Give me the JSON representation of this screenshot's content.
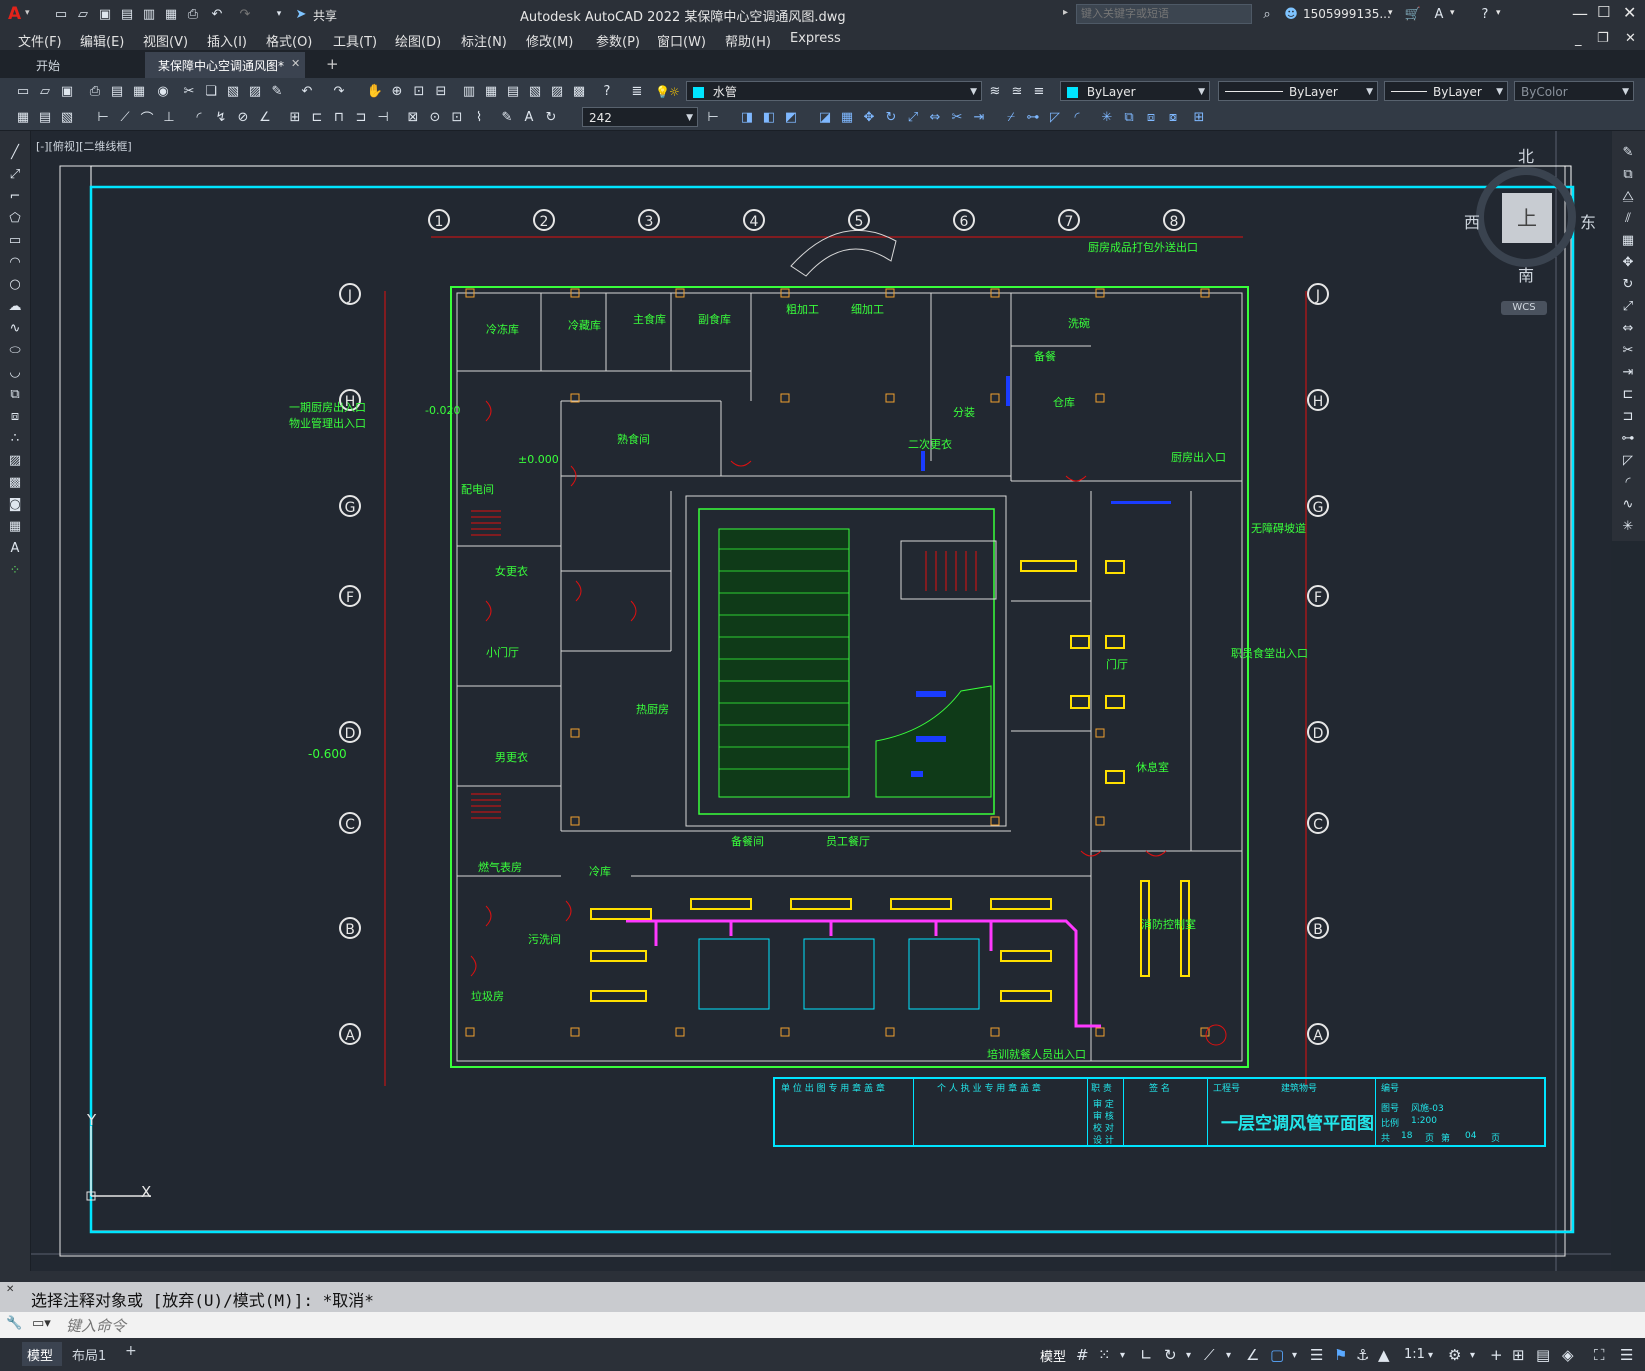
{
  "titlebar": {
    "app_logo": "A",
    "share_label": "共享",
    "window_title": "Autodesk AutoCAD 2022    某保障中心空调通风图.dwg",
    "search_placeholder": "键入关键字或短语",
    "user_name": "1505999135...",
    "help_icon": "question-circle-icon"
  },
  "menu": {
    "items": [
      "文件(F)",
      "编辑(E)",
      "视图(V)",
      "插入(I)",
      "格式(O)",
      "工具(T)",
      "绘图(D)",
      "标注(N)",
      "修改(M)",
      "参数(P)",
      "窗口(W)",
      "帮助(H)",
      "Express"
    ]
  },
  "tabs": {
    "start_label": "开始",
    "active_label": "某保障中心空调通风图*",
    "close_glyph": "✕",
    "add_glyph": "+"
  },
  "properties": {
    "layer_name": "水管",
    "color_value": "ByLayer",
    "linetype_value": "ByLayer",
    "lineweight_value": "ByLayer",
    "plotstyle_value": "ByColor",
    "dim_value": "242"
  },
  "viewport": {
    "label": "[-][俯视][二维线框]"
  },
  "viewcube": {
    "north": "北",
    "south": "南",
    "east": "东",
    "west": "西",
    "face": "上",
    "wcs_label": "WCS"
  },
  "ucs": {
    "y_label": "Y",
    "x_label": "X"
  },
  "drawing": {
    "column_axes": [
      "1",
      "2",
      "3",
      "4",
      "5",
      "6",
      "7",
      "8"
    ],
    "row_axes": [
      "J",
      "H",
      "G",
      "F",
      "D",
      "C",
      "B",
      "A"
    ],
    "room_labels": [
      {
        "text": "冷冻库"
      },
      {
        "text": "冷藏库"
      },
      {
        "text": "主食库"
      },
      {
        "text": "副食库"
      },
      {
        "text": "粗加工"
      },
      {
        "text": "细加工"
      },
      {
        "text": "洗碗"
      },
      {
        "text": "备餐"
      },
      {
        "text": "仓库"
      },
      {
        "text": "分装"
      },
      {
        "text": "厨房出入口"
      },
      {
        "text": "一期厨房出入口"
      },
      {
        "text": "物业管理出入口"
      },
      {
        "text": "熟食间"
      },
      {
        "text": "二次更衣"
      },
      {
        "text": "配电间"
      },
      {
        "text": "女更衣"
      },
      {
        "text": "男更衣"
      },
      {
        "text": "小门厅"
      },
      {
        "text": "热厨房"
      },
      {
        "text": "门厅"
      },
      {
        "text": "休息室"
      },
      {
        "text": "冷库"
      },
      {
        "text": "员工餐厅"
      },
      {
        "text": "备餐间"
      },
      {
        "text": "消防控制室"
      },
      {
        "text": "燃气表房"
      },
      {
        "text": "垃圾房"
      },
      {
        "text": "污洗间"
      },
      {
        "text": "无障碍坡道"
      },
      {
        "text": "职员食堂出入口"
      },
      {
        "text": "培训就餐人员出入口"
      },
      {
        "text": "厨房成品打包外送出口"
      },
      {
        "text": "±0.000"
      },
      {
        "text": "-0.600"
      },
      {
        "text": "-0.020"
      }
    ]
  },
  "title_block": {
    "stamp_unit": "单 位 出 图 专 用 章 盖 章",
    "stamp_person": "个 人 执 业 专 用 章 盖 章",
    "role_header": "职 责",
    "sign_header": "签 名",
    "roles": [
      "审 定",
      "审 核",
      "校 对",
      "设 计"
    ],
    "project_no_label": "工程号",
    "building_no_label": "建筑物号",
    "drawing_title": "一层空调风管平面图",
    "code_label": "编号",
    "drawing_no_label": "图号",
    "drawing_no_value": "风施-03",
    "scale_label": "比例",
    "scale_value": "1:200",
    "total_label": "共",
    "total_value": "18",
    "page_unit": "页",
    "sheet_label": "第",
    "sheet_value": "04",
    "sheet_unit": "页"
  },
  "command": {
    "history_text": "选择注释对象或 [放弃(U)/模式(M)]: *取消*",
    "input_placeholder": "键入命令"
  },
  "status": {
    "tabs": [
      "模型",
      "布局1"
    ],
    "add_glyph": "+",
    "model_label": "模型",
    "scale_label": "1:1"
  },
  "colors": {
    "accent": "#00e5ff",
    "wall": "#39ff3b",
    "grid_red": "#e01010",
    "duct_yellow": "#ffe000",
    "duct_magenta": "#ff39ff"
  }
}
